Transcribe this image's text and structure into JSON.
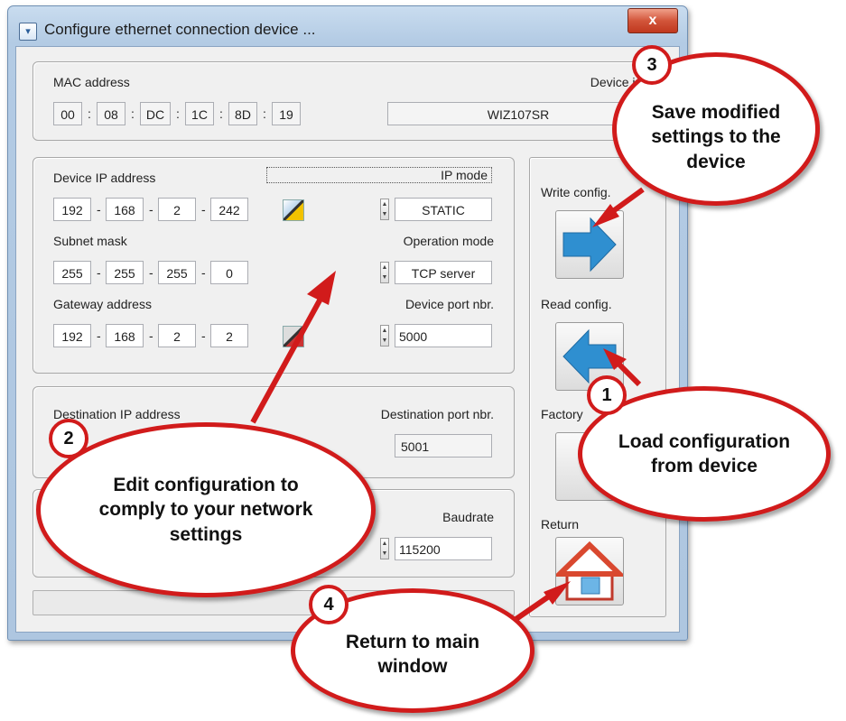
{
  "window": {
    "title": "Configure ethernet connection device ...",
    "close_glyph": "x"
  },
  "mac": {
    "label": "MAC address",
    "octets": [
      "00",
      "08",
      "DC",
      "1C",
      "8D",
      "19"
    ],
    "separator": ":"
  },
  "device_info": {
    "label": "Device info",
    "value": "WIZ107SR"
  },
  "ip": {
    "device_ip_label": "Device IP address",
    "device_ip": [
      "192",
      "168",
      "2",
      "242"
    ],
    "subnet_label": "Subnet mask",
    "subnet": [
      "255",
      "255",
      "255",
      "0"
    ],
    "gateway_label": "Gateway address",
    "gateway": [
      "192",
      "168",
      "2",
      "2"
    ],
    "separator": "-",
    "ip_mode_label": "IP mode",
    "ip_mode_value": "STATIC",
    "operation_mode_label": "Operation mode",
    "operation_mode_value": "TCP server",
    "port_label": "Device port nbr.",
    "port_value": "5000"
  },
  "destination": {
    "ip_label": "Destination IP address",
    "port_label": "Destination port nbr.",
    "port_value": "5001"
  },
  "serial": {
    "baud_label": "Baudrate",
    "baud_value": "115200"
  },
  "side": {
    "write_label": "Write config.",
    "read_label": "Read config.",
    "factory_label": "Factory",
    "return_label": "Return"
  },
  "callouts": {
    "c1": {
      "num": "1",
      "text": "Load configuration from device"
    },
    "c2": {
      "num": "2",
      "text": "Edit configuration to comply to your network settings"
    },
    "c3": {
      "num": "3",
      "text": "Save modified settings to the device"
    },
    "c4": {
      "num": "4",
      "text": "Return to main window"
    }
  },
  "colors": {
    "callout_border": "#d11b1b",
    "arrow_blue": "#2f8fd0"
  }
}
